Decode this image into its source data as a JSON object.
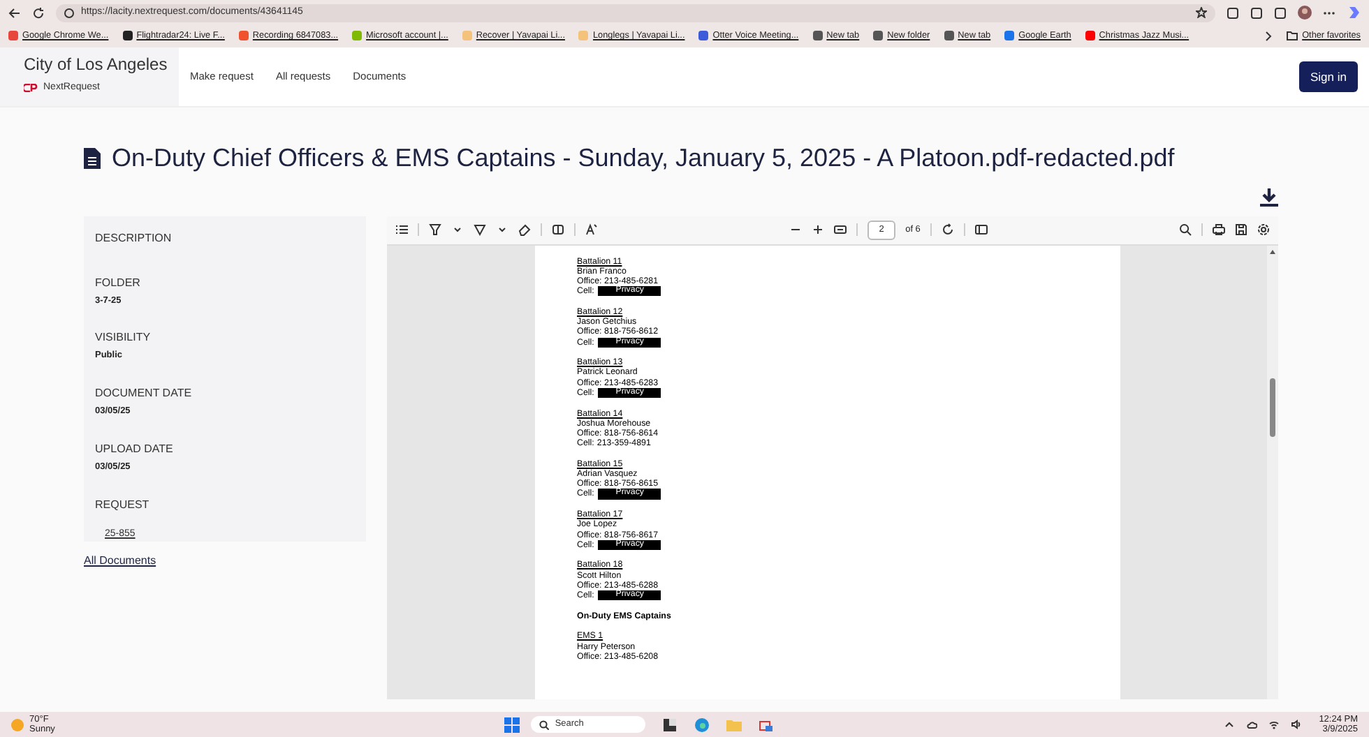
{
  "browser": {
    "url": "https://lacity.nextrequest.com/documents/43641145",
    "bookmarks": [
      {
        "label": "Google Chrome We...",
        "color": "#e8453c"
      },
      {
        "label": "Flightradar24: Live F...",
        "color": "#222222"
      },
      {
        "label": "Recording 6847083...",
        "color": "#f0522d"
      },
      {
        "label": "Microsoft account |...",
        "color": "#7fba00"
      },
      {
        "label": "Recover | Yavapai Li...",
        "color": "#f4c27a"
      },
      {
        "label": "Longlegs | Yavapai Li...",
        "color": "#f4c27a"
      },
      {
        "label": "Otter Voice Meeting...",
        "color": "#3b5bdb"
      },
      {
        "label": "New tab",
        "color": "#555555"
      },
      {
        "label": "New folder",
        "color": "#555555"
      },
      {
        "label": "New tab",
        "color": "#555555"
      },
      {
        "label": "Google Earth",
        "color": "#1a73e8"
      },
      {
        "label": "Christmas Jazz Musi...",
        "color": "#ff0000"
      }
    ],
    "other_favorites": "Other favorites"
  },
  "site": {
    "city": "City of Los Angeles",
    "brand": "NextRequest",
    "nav": [
      "Make request",
      "All requests",
      "Documents"
    ],
    "sign_in": "Sign in"
  },
  "title": "On-Duty Chief Officers & EMS Captains - Sunday, January 5, 2025 - A Platoon.pdf-redacted.pdf",
  "sidebar": {
    "fields": [
      {
        "label": "DESCRIPTION",
        "kind": "empty"
      },
      {
        "label": "FOLDER",
        "value": "3-7-25",
        "kind": "text"
      },
      {
        "label": "VISIBILITY",
        "value": "Public",
        "kind": "text"
      },
      {
        "label": "DOCUMENT DATE",
        "value": "03/05/25",
        "kind": "text"
      },
      {
        "label": "UPLOAD DATE",
        "value": "03/05/25",
        "kind": "text"
      },
      {
        "label": "REQUEST",
        "value": "25-855",
        "kind": "link"
      }
    ],
    "all_documents": "All Documents"
  },
  "viewer": {
    "page": "2",
    "page_count": "of 6",
    "items": [
      {
        "kind": "entry",
        "heading": "Battalion 11",
        "name": "Brian Franco",
        "office": "Office: 213-485-6281",
        "cell": {
          "label": "Cell:",
          "value": "Privacy",
          "redacted": true
        }
      },
      {
        "kind": "entry",
        "heading": "Battalion 12",
        "name": "Jason Getchius",
        "office": "Office: 818-756-8612",
        "cell": {
          "label": "Cell:",
          "value": "Privacy",
          "redacted": true
        }
      },
      {
        "kind": "entry",
        "heading": "Battalion 13",
        "name": "Patrick Leonard",
        "office": "Office: 213-485-6283",
        "cell": {
          "label": "Cell:",
          "value": "Privacy",
          "redacted": true
        }
      },
      {
        "kind": "entry",
        "heading": "Battalion 14",
        "name": "Joshua Morehouse",
        "office": "Office: 818-756-8614",
        "cell": {
          "label": "Cell:",
          "value": "213-359-4891",
          "redacted": false
        }
      },
      {
        "kind": "entry",
        "heading": "Battalion 15",
        "name": "Adrian Vasquez",
        "office": "Office: 818-756-8615",
        "cell": {
          "label": "Cell:",
          "value": "Privacy",
          "redacted": true
        }
      },
      {
        "kind": "entry",
        "heading": "Battalion 17",
        "name": "Joe Lopez",
        "office": "Office: 818-756-8617",
        "cell": {
          "label": "Cell:",
          "value": "Privacy",
          "redacted": true
        }
      },
      {
        "kind": "entry",
        "heading": "Battalion 18",
        "name": "Scott Hilton",
        "office": "Office: 213-485-6288",
        "cell": {
          "label": "Cell:",
          "value": "Privacy",
          "redacted": true
        }
      },
      {
        "kind": "section",
        "heading": "On-Duty EMS Captains"
      },
      {
        "kind": "entry",
        "heading": "EMS 1",
        "name": "Harry Peterson",
        "office": "Office: 213-485-6208"
      }
    ]
  },
  "taskbar": {
    "temperature": "70°F",
    "weather": "Sunny",
    "search_placeholder": "Search",
    "time": "12:24 PM",
    "date": "3/9/2025"
  }
}
